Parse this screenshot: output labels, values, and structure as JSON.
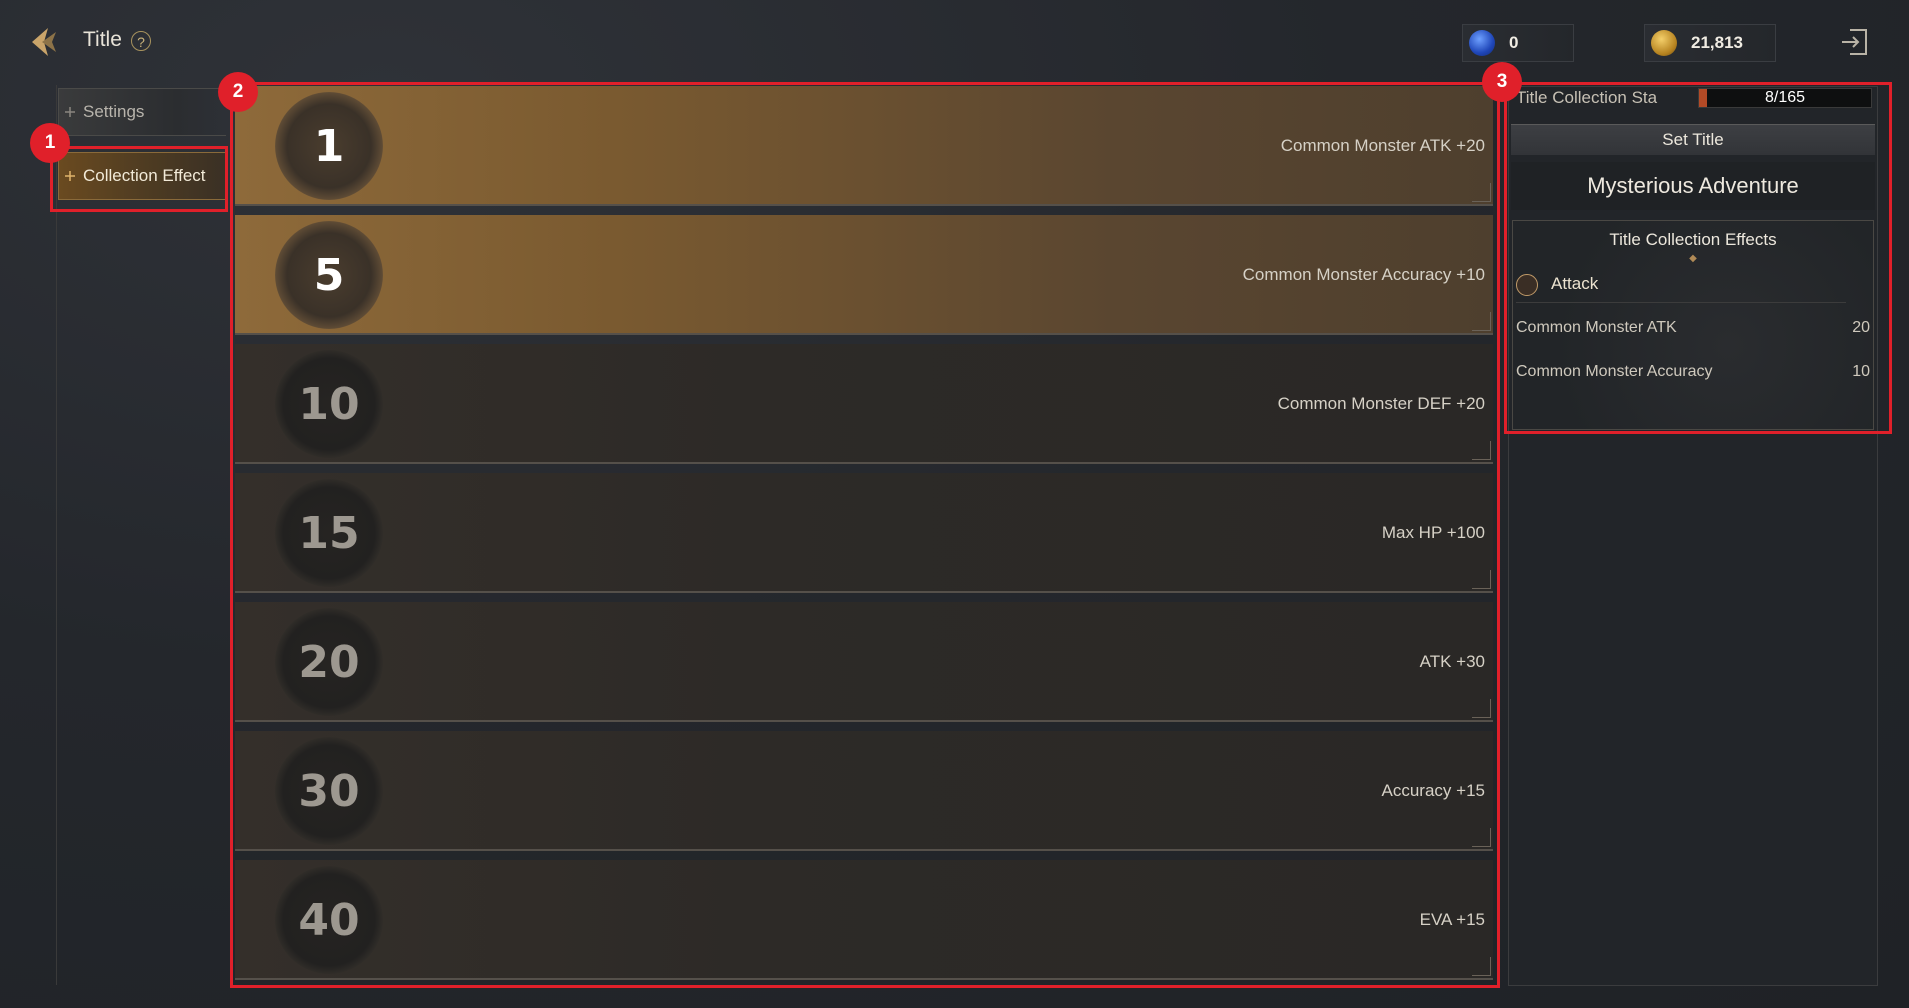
{
  "header": {
    "title": "Title",
    "help_glyph": "?",
    "currencies": [
      {
        "icon": "blue-gem-icon",
        "value": "0",
        "color": "#2b5fd8"
      },
      {
        "icon": "gold-coin-icon",
        "value": "21,813",
        "color": "#c9962a"
      }
    ]
  },
  "nav": {
    "items": [
      {
        "label": "Settings",
        "active": false
      },
      {
        "label": "Collection Effect",
        "active": true
      }
    ]
  },
  "annotations": [
    "1",
    "2",
    "3"
  ],
  "rows": [
    {
      "level": "1",
      "effect": "Common Monster ATK +20",
      "unlocked": true
    },
    {
      "level": "5",
      "effect": "Common Monster Accuracy +10",
      "unlocked": true
    },
    {
      "level": "10",
      "effect": "Common Monster DEF +20",
      "unlocked": false
    },
    {
      "level": "15",
      "effect": "Max HP +100",
      "unlocked": false
    },
    {
      "level": "20",
      "effect": "ATK +30",
      "unlocked": false
    },
    {
      "level": "30",
      "effect": "Accuracy +15",
      "unlocked": false
    },
    {
      "level": "40",
      "effect": "EVA +15",
      "unlocked": false
    }
  ],
  "right_panel": {
    "progress_label": "Title Collection Sta",
    "progress_text": "8/165",
    "progress_fraction": 0.048,
    "set_title_label": "Set Title",
    "current_title": "Mysterious Adventure",
    "effects_title": "Title Collection Effects",
    "category": "Attack",
    "stats": [
      {
        "name": "Common Monster ATK",
        "value": "20"
      },
      {
        "name": "Common Monster Accuracy",
        "value": "10"
      }
    ]
  },
  "colors": {
    "accent_red": "#e0202a",
    "progress": "#b34a26"
  }
}
